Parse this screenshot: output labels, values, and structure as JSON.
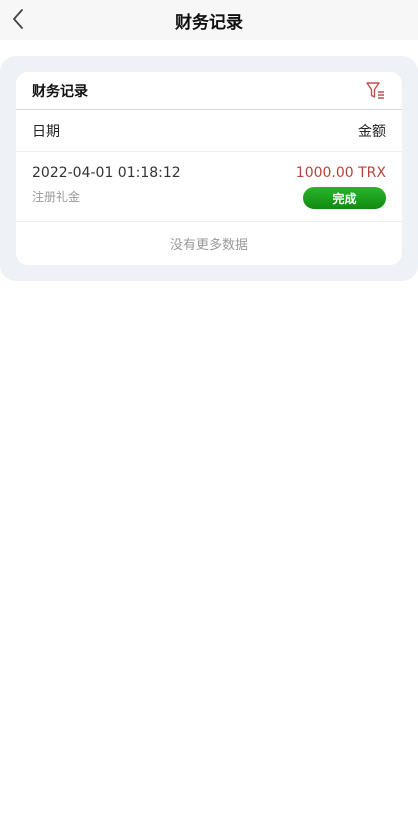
{
  "header": {
    "title": "财务记录"
  },
  "card": {
    "title": "财务记录",
    "columns": {
      "date": "日期",
      "amount": "金额"
    },
    "records": [
      {
        "datetime": "2022-04-01 01:18:12",
        "type": "注册礼金",
        "amount": "1000.00 TRX",
        "status": "完成"
      }
    ],
    "no_more": "没有更多数据"
  },
  "colors": {
    "amount": "#b8433d",
    "status_green": "#1a9e1a",
    "filter_icon": "#c0504d"
  },
  "icons": {
    "back": "chevron-left-icon",
    "filter": "filter-icon"
  }
}
